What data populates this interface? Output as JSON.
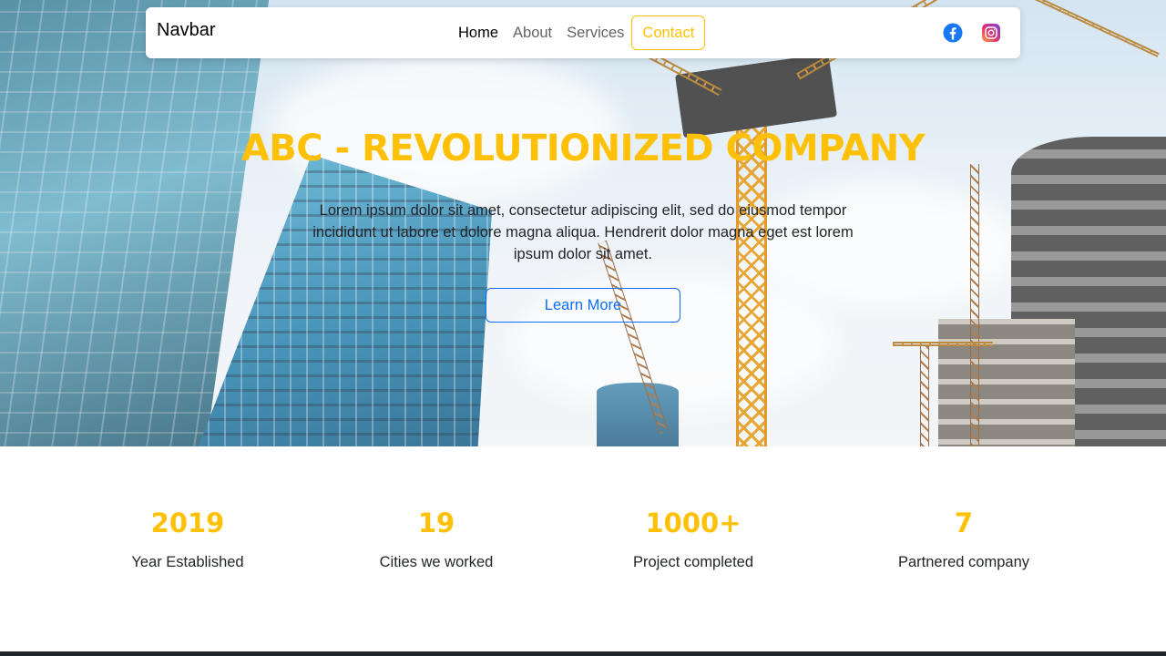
{
  "navbar": {
    "brand": "Navbar",
    "links": [
      {
        "label": "Home",
        "active": true
      },
      {
        "label": "About",
        "active": false
      },
      {
        "label": "Services",
        "active": false
      }
    ],
    "contact_label": "Contact",
    "social": [
      "facebook-icon",
      "instagram-icon"
    ]
  },
  "hero": {
    "title": "ABC - REVOLUTIONIZED COMPANY",
    "text": "Lorem ipsum dolor sit amet, consectetur adipiscing elit, sed do eiusmod tempor incididunt ut labore et dolore magna aliqua. Hendrerit dolor magna eget est lorem ipsum dolor sit amet.",
    "button_label": "Learn More",
    "background": "construction cranes and glass skyscrapers"
  },
  "stats": [
    {
      "value": "2019",
      "label": "Year Established"
    },
    {
      "value": "19",
      "label": "Cities we worked"
    },
    {
      "value": "1000+",
      "label": "Project completed"
    },
    {
      "value": "7",
      "label": "Partnered company"
    }
  ],
  "colors": {
    "accent": "#ffc107",
    "primary": "#0d6efd",
    "text": "#212529",
    "footer": "#212529"
  }
}
